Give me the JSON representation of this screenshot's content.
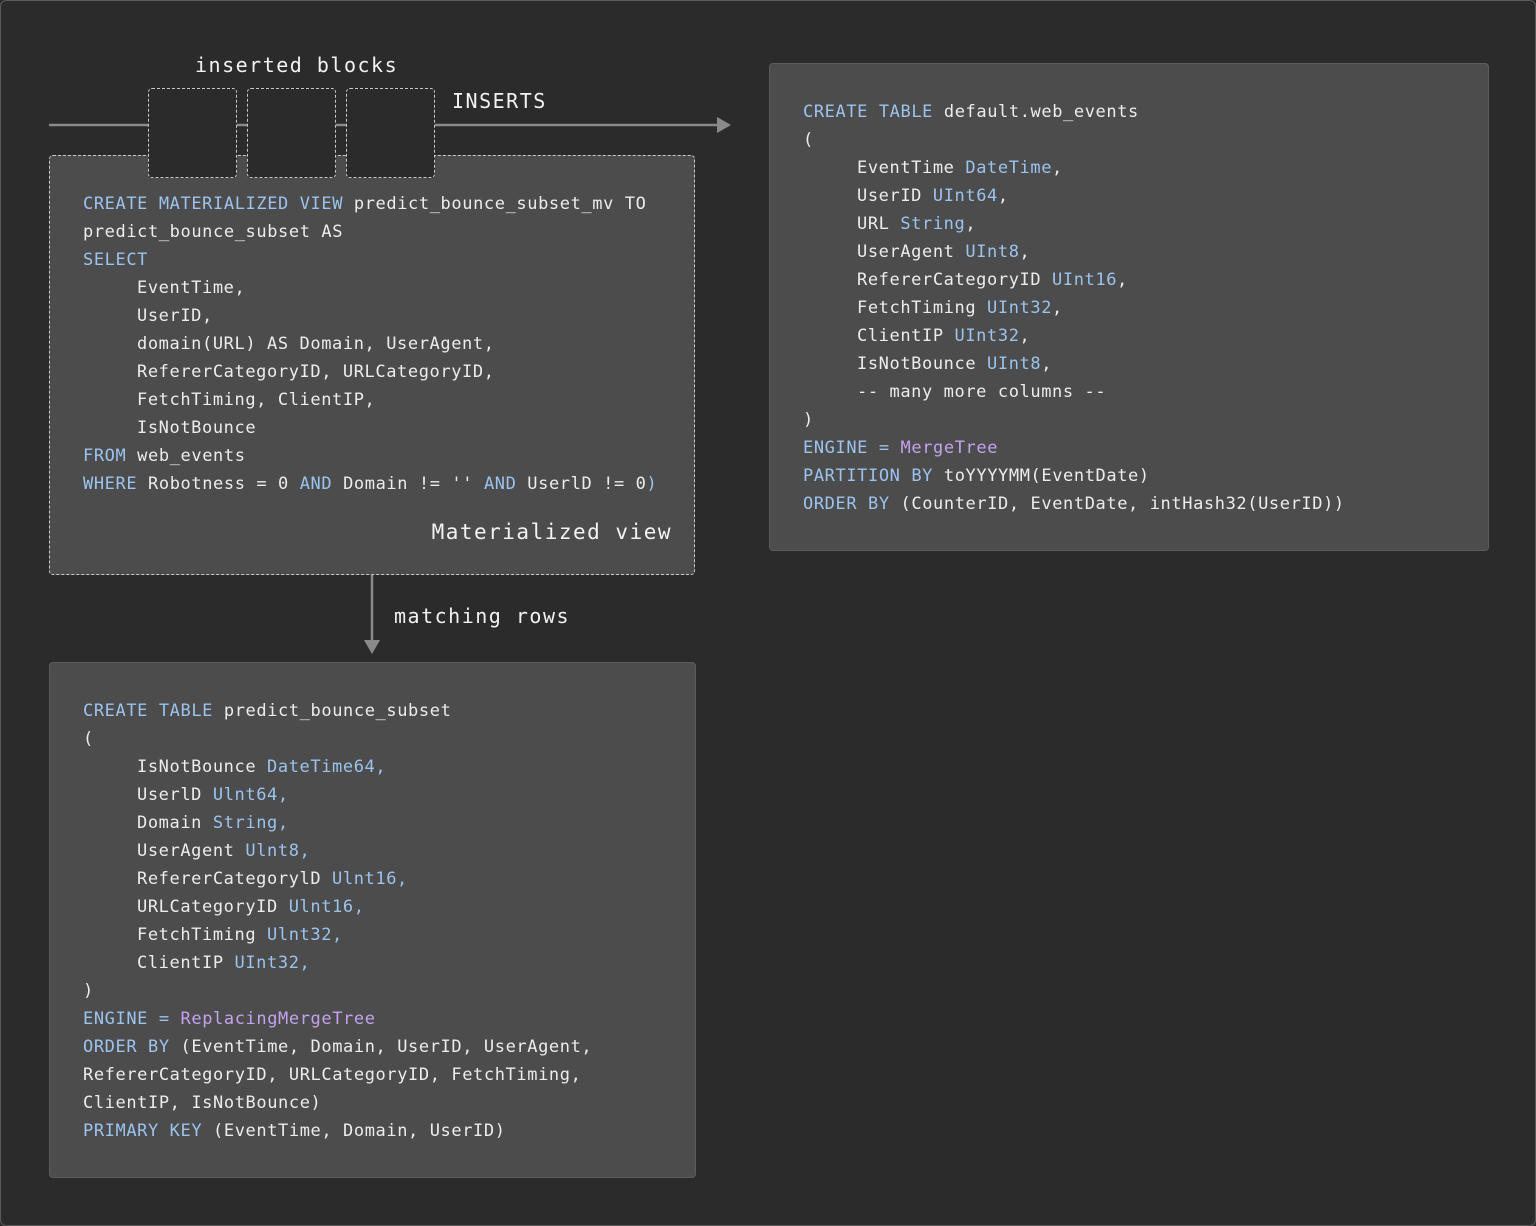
{
  "labels": {
    "inserted_blocks": "inserted blocks",
    "inserts": "INSERTS",
    "materialized_view": "Materialized view",
    "matching_rows": "matching rows"
  },
  "colors": {
    "background": "#2b2b2b",
    "panel": "#4c4c4c",
    "keyword": "#9cc3ee",
    "engine": "#c4a2ee",
    "text": "#ececec",
    "connector": "#8a8a8a"
  },
  "mv_code": [
    [
      {
        "t": "CREATE MATERIALIZED VIEW",
        "c": "kw"
      },
      {
        "t": " predict_bounce_subset_mv TO"
      }
    ],
    [
      {
        "t": "predict_bounce_subset AS"
      }
    ],
    [
      {
        "t": "SELECT",
        "c": "kw"
      }
    ],
    [
      {
        "t": "EventTime,",
        "i": 1
      }
    ],
    [
      {
        "t": "UserID,",
        "i": 1
      }
    ],
    [
      {
        "t": "domain(URL) AS Domain, UserAgent,",
        "i": 1
      }
    ],
    [
      {
        "t": "RefererCategoryID, URLCategoryID,",
        "i": 1
      }
    ],
    [
      {
        "t": "FetchTiming, ClientIP,",
        "i": 1
      }
    ],
    [
      {
        "t": "IsNotBounce",
        "i": 1
      }
    ],
    [
      {
        "t": "FROM",
        "c": "kw"
      },
      {
        "t": " web_events"
      }
    ],
    [
      {
        "t": "WHERE",
        "c": "kw"
      },
      {
        "t": " Robotness = 0 "
      },
      {
        "t": "AND",
        "c": "kw"
      },
      {
        "t": " Domain != '' "
      },
      {
        "t": "AND",
        "c": "kw"
      },
      {
        "t": " UserlD != 0"
      },
      {
        "t": ")",
        "c": "kw"
      }
    ]
  ],
  "web_events_code": [
    [
      {
        "t": "CREATE TABLE",
        "c": "kw"
      },
      {
        "t": " default.web_events"
      }
    ],
    [
      {
        "t": "("
      }
    ],
    [
      {
        "t": "EventTime ",
        "i": 1
      },
      {
        "t": "DateTime",
        "c": "ty"
      },
      {
        "t": ","
      }
    ],
    [
      {
        "t": "UserID ",
        "i": 1
      },
      {
        "t": "UInt64",
        "c": "ty"
      },
      {
        "t": ","
      }
    ],
    [
      {
        "t": "URL ",
        "i": 1
      },
      {
        "t": "String",
        "c": "ty"
      },
      {
        "t": ","
      }
    ],
    [
      {
        "t": "UserAgent ",
        "i": 1
      },
      {
        "t": "UInt8",
        "c": "ty"
      },
      {
        "t": ","
      }
    ],
    [
      {
        "t": "RefererCategoryID ",
        "i": 1
      },
      {
        "t": "UInt16",
        "c": "ty"
      },
      {
        "t": ","
      }
    ],
    [
      {
        "t": "FetchTiming ",
        "i": 1
      },
      {
        "t": "UInt32",
        "c": "ty"
      },
      {
        "t": ","
      }
    ],
    [
      {
        "t": "ClientIP ",
        "i": 1
      },
      {
        "t": "UInt32",
        "c": "ty"
      },
      {
        "t": ","
      }
    ],
    [
      {
        "t": "IsNotBounce ",
        "i": 1
      },
      {
        "t": "UInt8",
        "c": "ty"
      },
      {
        "t": ","
      }
    ],
    [
      {
        "t": "-- many more columns --",
        "i": 1
      }
    ],
    [
      {
        "t": ")"
      }
    ],
    [
      {
        "t": "ENGINE",
        "c": "kw"
      },
      {
        "t": " = ",
        "c": "kw"
      },
      {
        "t": "MergeTree",
        "c": "en"
      }
    ],
    [
      {
        "t": "PARTITION BY",
        "c": "kw"
      },
      {
        "t": " toYYYYMM(EventDate)"
      }
    ],
    [
      {
        "t": "ORDER BY",
        "c": "kw"
      },
      {
        "t": " (CounterID, EventDate, intHash32(UserID))"
      }
    ]
  ],
  "subset_code": [
    [
      {
        "t": "CREATE TABLE",
        "c": "kw"
      },
      {
        "t": " predict_bounce_subset"
      }
    ],
    [
      {
        "t": "("
      }
    ],
    [
      {
        "t": "IsNotBounce ",
        "i": 1
      },
      {
        "t": "DateTime64,",
        "c": "ty"
      }
    ],
    [
      {
        "t": "UserlD ",
        "i": 1
      },
      {
        "t": "Ulnt64,",
        "c": "ty"
      }
    ],
    [
      {
        "t": "Domain ",
        "i": 1
      },
      {
        "t": "String,",
        "c": "ty"
      }
    ],
    [
      {
        "t": "UserAgent ",
        "i": 1
      },
      {
        "t": "Ulnt8,",
        "c": "ty"
      }
    ],
    [
      {
        "t": "RefererCategorylD ",
        "i": 1
      },
      {
        "t": "Ulnt16,",
        "c": "ty"
      }
    ],
    [
      {
        "t": "URLCategoryID ",
        "i": 1
      },
      {
        "t": "Ulnt16,",
        "c": "ty"
      }
    ],
    [
      {
        "t": "FetchTiming ",
        "i": 1
      },
      {
        "t": "Ulnt32,",
        "c": "ty"
      }
    ],
    [
      {
        "t": "ClientIP ",
        "i": 1
      },
      {
        "t": "UInt32,",
        "c": "ty"
      }
    ],
    [
      {
        "t": ")"
      }
    ],
    [
      {
        "t": "ENGINE",
        "c": "kw"
      },
      {
        "t": " = ",
        "c": "kw"
      },
      {
        "t": "ReplacingMergeTree",
        "c": "en"
      }
    ],
    [
      {
        "t": "ORDER BY",
        "c": "kw"
      },
      {
        "t": " (EventTime, Domain, UserID, UserAgent,"
      }
    ],
    [
      {
        "t": "RefererCategoryID, URLCategoryID, FetchTiming,"
      }
    ],
    [
      {
        "t": "ClientIP, IsNotBounce)"
      }
    ],
    [
      {
        "t": "PRIMARY KEY",
        "c": "kw"
      },
      {
        "t": " (EventTime, Domain, UserID)"
      }
    ]
  ]
}
